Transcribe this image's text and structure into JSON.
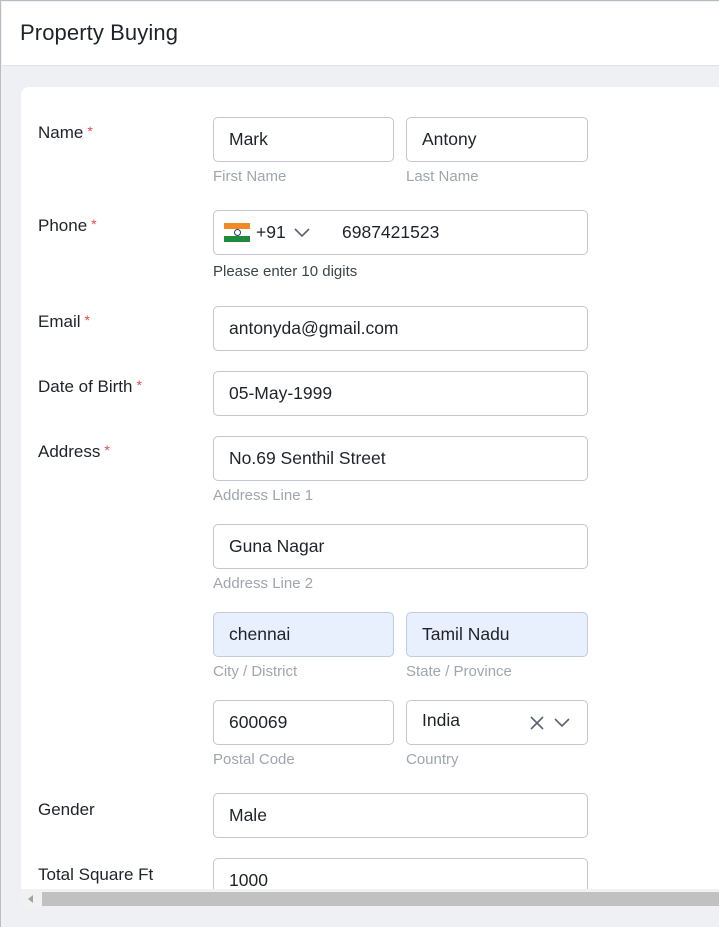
{
  "header": {
    "title": "Property Buying"
  },
  "form": {
    "name": {
      "label": "Name",
      "required_mark": "*",
      "first_name": "Mark",
      "last_name": "Antony",
      "first_caption": "First Name",
      "last_caption": "Last Name"
    },
    "phone": {
      "label": "Phone",
      "required_mark": "*",
      "country_flag": "india-flag-icon",
      "dial_code": "+91",
      "number": "6987421523",
      "hint": "Please enter 10 digits"
    },
    "email": {
      "label": "Email",
      "required_mark": "*",
      "value": "antonyda@gmail.com"
    },
    "dob": {
      "label": "Date of Birth",
      "required_mark": "*",
      "value": "05-May-1999"
    },
    "address": {
      "label": "Address",
      "required_mark": "*",
      "line1": "No.69 Senthil Street",
      "line1_caption": "Address Line 1",
      "line2": "Guna Nagar",
      "line2_caption": "Address Line 2",
      "city": "chennai",
      "city_caption": "City / District",
      "state": "Tamil Nadu",
      "state_caption": "State / Province",
      "postal": "600069",
      "postal_caption": "Postal Code",
      "country": "India",
      "country_caption": "Country"
    },
    "gender": {
      "label": "Gender",
      "value": "Male"
    },
    "square_ft": {
      "label": "Total Square Ft",
      "value": "1000"
    }
  },
  "colors": {
    "required": "#e5484d",
    "autofill_bg": "#e8f0fe",
    "caption": "#a0a5ae",
    "border": "#c3c7ce"
  }
}
